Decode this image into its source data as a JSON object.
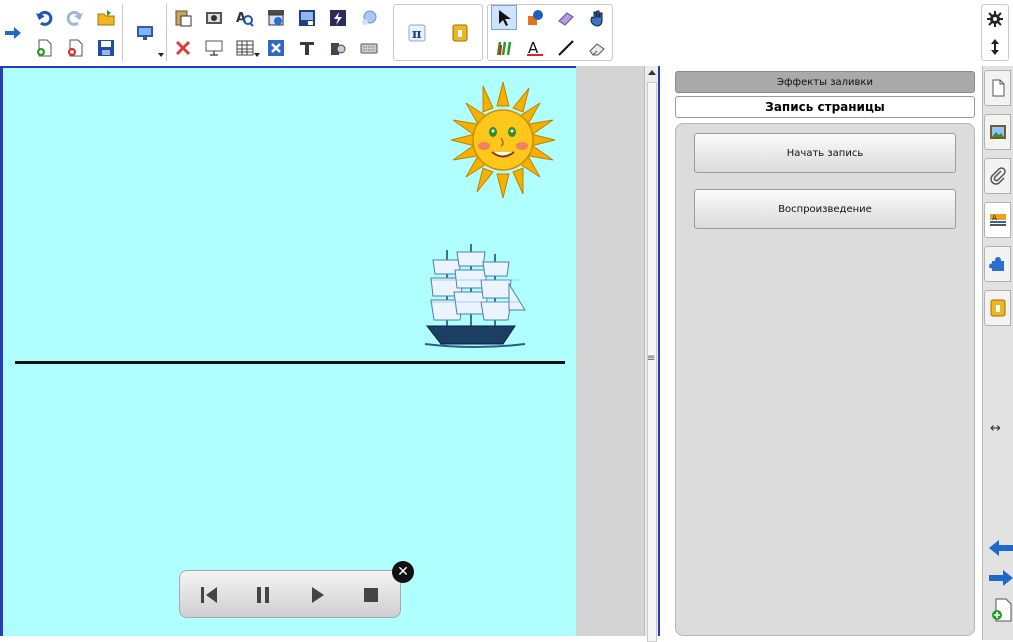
{
  "panel": {
    "fill_effects_tab": "Эффекты заливки",
    "page_recording_title": "Запись страницы",
    "start_recording_button": "Начать запись",
    "playback_button": "Воспроизведение"
  },
  "toolbar": {
    "icons": [
      "forward-nav-icon",
      "undo-icon",
      "redo-icon",
      "open-folder-icon",
      "new-page-icon",
      "delete-page-icon",
      "save-icon",
      "display-icon",
      "paste-icon",
      "screenshot-icon",
      "spellcheck-icon",
      "screen-shade-icon",
      "capture-icon",
      "flash-icon",
      "orb-icon",
      "delete-icon",
      "screen-board-icon",
      "table-icon",
      "close-box-icon",
      "text-tool-icon",
      "puzzle-icon",
      "keyboard-icon",
      "math-icon",
      "add-on-icon",
      "select-icon",
      "magic-pen-icon",
      "eraser-shape-icon",
      "hand-icon",
      "creative-pens-icon",
      "text-icon",
      "line-icon",
      "eraser-icon",
      "settings-icon",
      "toolbar-move-icon"
    ]
  },
  "playback": {
    "close_label": "✕",
    "controls": [
      "skip-back-icon",
      "pause-icon",
      "play-icon",
      "stop-icon"
    ]
  },
  "side_tabs": [
    "page-sorter-icon",
    "gallery-icon",
    "attachments-icon",
    "properties-icon",
    "add-ons-icon",
    "extra-tool-icon"
  ],
  "colors": {
    "canvas_background": "#b0ffff",
    "selection_accent": "#2a3bb5",
    "panel_background": "#dcdcdc"
  }
}
